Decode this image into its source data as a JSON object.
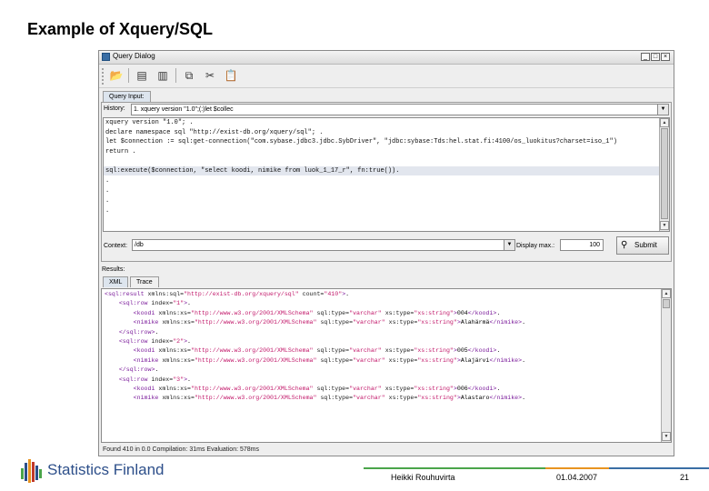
{
  "slide": {
    "title": "Example of Xquery/SQL"
  },
  "window": {
    "title": "Query Dialog",
    "controls": {
      "minimize": "_",
      "maximize": "□",
      "close": "×"
    }
  },
  "toolbar": {
    "buttons": [
      {
        "name": "open-query-button",
        "icon": "folder-open-icon",
        "glyph": "📂"
      },
      {
        "name": "save-button",
        "icon": "save-icon",
        "glyph": "▤"
      },
      {
        "name": "save-as-button",
        "icon": "save-as-icon",
        "glyph": "▥"
      },
      {
        "name": "copy-button",
        "icon": "copy-icon",
        "glyph": "⧉"
      },
      {
        "name": "cut-button",
        "icon": "scissors-icon",
        "glyph": "✂"
      },
      {
        "name": "paste-button",
        "icon": "paste-icon",
        "glyph": "📋"
      }
    ]
  },
  "query_input": {
    "tab_label": "Query Input:",
    "history_label": "History:",
    "history_value": "1. xquery version \"1.0\";(:)let $collec",
    "code_lines": [
      "xquery version \"1.0\"; .",
      "declare namespace sql \"http://exist-db.org/xquery/sql\"; .",
      "let $connection := sql:get-connection(\"com.sybase.jdbc3.jdbc.SybDriver\", \"jdbc:sybase:Tds:hel.stat.fi:4100/os_luokitus?charset=iso_1\")",
      "return .",
      "sql:execute($connection, \"select koodi, nimike from luok_1_17_r\", fn:true()).",
      ".",
      ".",
      ".",
      "."
    ],
    "context_label": "Context:",
    "context_value": "/db",
    "display_max_label": "Display max.:",
    "display_max_value": "100",
    "submit_label": "Submit",
    "submit_icon": "binoculars-icon"
  },
  "results": {
    "label": "Results:",
    "tabs": [
      {
        "label": "XML"
      },
      {
        "label": "Trace"
      }
    ],
    "xml_lines": [
      {
        "parts": [
          [
            "tag",
            "<sql:result "
          ],
          [
            "attr",
            "xmlns:sql="
          ],
          [
            "val",
            "\"http://exist-db.org/xquery/sql\""
          ],
          [
            "attr",
            " count="
          ],
          [
            "val",
            "\"410\""
          ],
          [
            "tag",
            ">"
          ],
          [
            "txt",
            "."
          ]
        ]
      },
      {
        "parts": [
          [
            "txt",
            "    "
          ],
          [
            "tag",
            "<sql:row "
          ],
          [
            "attr",
            "index="
          ],
          [
            "val",
            "\"1\""
          ],
          [
            "tag",
            ">"
          ],
          [
            "txt",
            "."
          ]
        ]
      },
      {
        "parts": [
          [
            "txt",
            "        "
          ],
          [
            "tag",
            "<koodi "
          ],
          [
            "attr",
            "xmlns:xs="
          ],
          [
            "val",
            "\"http://www.w3.org/2001/XMLSchema\""
          ],
          [
            "attr",
            " sql:type="
          ],
          [
            "val",
            "\"varchar\""
          ],
          [
            "attr",
            " xs:type="
          ],
          [
            "val",
            "\"xs:string\""
          ],
          [
            "tag",
            ">"
          ],
          [
            "txt",
            "004"
          ],
          [
            "tag",
            "</koodi>"
          ],
          [
            "txt",
            "."
          ]
        ]
      },
      {
        "parts": [
          [
            "txt",
            "        "
          ],
          [
            "tag",
            "<nimike "
          ],
          [
            "attr",
            "xmlns:xs="
          ],
          [
            "val",
            "\"http://www.w3.org/2001/XMLSchema\""
          ],
          [
            "attr",
            " sql:type="
          ],
          [
            "val",
            "\"varchar\""
          ],
          [
            "attr",
            " xs:type="
          ],
          [
            "val",
            "\"xs:string\""
          ],
          [
            "tag",
            ">"
          ],
          [
            "txt",
            "Alahärmä"
          ],
          [
            "tag",
            "</nimike>"
          ],
          [
            "txt",
            "."
          ]
        ]
      },
      {
        "parts": [
          [
            "txt",
            "    "
          ],
          [
            "tag",
            "</sql:row>"
          ],
          [
            "txt",
            "."
          ]
        ]
      },
      {
        "parts": [
          [
            "txt",
            "    "
          ],
          [
            "tag",
            "<sql:row "
          ],
          [
            "attr",
            "index="
          ],
          [
            "val",
            "\"2\""
          ],
          [
            "tag",
            ">"
          ],
          [
            "txt",
            "."
          ]
        ]
      },
      {
        "parts": [
          [
            "txt",
            "        "
          ],
          [
            "tag",
            "<koodi "
          ],
          [
            "attr",
            "xmlns:xs="
          ],
          [
            "val",
            "\"http://www.w3.org/2001/XMLSchema\""
          ],
          [
            "attr",
            " sql:type="
          ],
          [
            "val",
            "\"varchar\""
          ],
          [
            "attr",
            " xs:type="
          ],
          [
            "val",
            "\"xs:string\""
          ],
          [
            "tag",
            ">"
          ],
          [
            "txt",
            "005"
          ],
          [
            "tag",
            "</koodi>"
          ],
          [
            "txt",
            "."
          ]
        ]
      },
      {
        "parts": [
          [
            "txt",
            "        "
          ],
          [
            "tag",
            "<nimike "
          ],
          [
            "attr",
            "xmlns:xs="
          ],
          [
            "val",
            "\"http://www.w3.org/2001/XMLSchema\""
          ],
          [
            "attr",
            " sql:type="
          ],
          [
            "val",
            "\"varchar\""
          ],
          [
            "attr",
            " xs:type="
          ],
          [
            "val",
            "\"xs:string\""
          ],
          [
            "tag",
            ">"
          ],
          [
            "txt",
            "Alajärvi"
          ],
          [
            "tag",
            "</nimike>"
          ],
          [
            "txt",
            "."
          ]
        ]
      },
      {
        "parts": [
          [
            "txt",
            "    "
          ],
          [
            "tag",
            "</sql:row>"
          ],
          [
            "txt",
            "."
          ]
        ]
      },
      {
        "parts": [
          [
            "txt",
            "    "
          ],
          [
            "tag",
            "<sql:row "
          ],
          [
            "attr",
            "index="
          ],
          [
            "val",
            "\"3\""
          ],
          [
            "tag",
            ">"
          ],
          [
            "txt",
            "."
          ]
        ]
      },
      {
        "parts": [
          [
            "txt",
            "        "
          ],
          [
            "tag",
            "<koodi "
          ],
          [
            "attr",
            "xmlns:xs="
          ],
          [
            "val",
            "\"http://www.w3.org/2001/XMLSchema\""
          ],
          [
            "attr",
            " sql:type="
          ],
          [
            "val",
            "\"varchar\""
          ],
          [
            "attr",
            " xs:type="
          ],
          [
            "val",
            "\"xs:string\""
          ],
          [
            "tag",
            ">"
          ],
          [
            "txt",
            "006"
          ],
          [
            "tag",
            "</koodi>"
          ],
          [
            "txt",
            "."
          ]
        ]
      },
      {
        "parts": [
          [
            "txt",
            "        "
          ],
          [
            "tag",
            "<nimike "
          ],
          [
            "attr",
            "xmlns:xs="
          ],
          [
            "val",
            "\"http://www.w3.org/2001/XMLSchema\""
          ],
          [
            "attr",
            " sql:type="
          ],
          [
            "val",
            "\"varchar\""
          ],
          [
            "attr",
            " xs:type="
          ],
          [
            "val",
            "\"xs:string\""
          ],
          [
            "tag",
            ">"
          ],
          [
            "txt",
            "Alastaro"
          ],
          [
            "tag",
            "</nimike>"
          ],
          [
            "txt",
            "."
          ]
        ]
      }
    ],
    "status": "Found 410 in 0.0 Compilation: 31ms Evaluation: 578ms"
  },
  "footer": {
    "logo": "Statistics Finland",
    "author": "Heikki Rouhuvirta",
    "date": "01.04.2007",
    "page": "21"
  },
  "colors": {
    "xml_tag": "#7a1a9a",
    "xml_value": "#c2186a",
    "brand_blue": "#2d4f8a",
    "footer_green": "#4aa54a",
    "footer_orange": "#e89420"
  }
}
